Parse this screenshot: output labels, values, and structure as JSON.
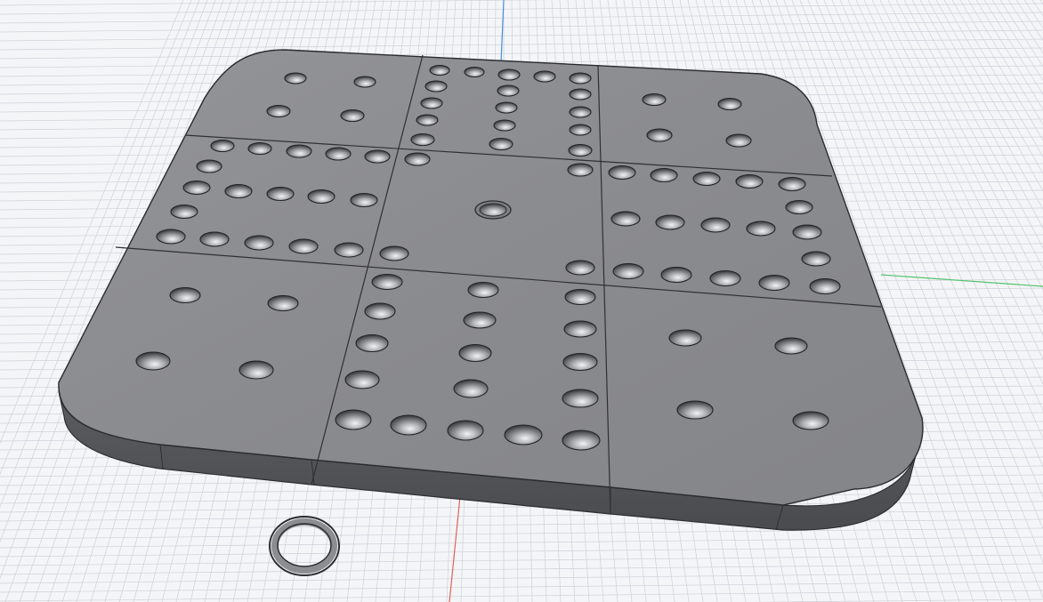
{
  "viewport": {
    "type": "3d-cad-viewport",
    "projection": "perspective",
    "grid": "on",
    "background_color": "#f4f5f7",
    "grid_color": "#c9ced6",
    "axis_colors": {
      "x": "#e0605a",
      "y": "#56c26f",
      "z": "#4a8fe6"
    }
  },
  "model": {
    "name": "",
    "body_color": "#8d8e92",
    "shape": "rounded square game board, 3x3 sections",
    "sections": [
      {
        "position": "top-left",
        "holes": 4
      },
      {
        "position": "top-center",
        "holes": 21
      },
      {
        "position": "top-right",
        "holes": 4
      },
      {
        "position": "middle-left",
        "holes": 21
      },
      {
        "position": "center",
        "holes": 1
      },
      {
        "position": "middle-right",
        "holes": 21
      },
      {
        "position": "bottom-left",
        "holes": 4
      },
      {
        "position": "bottom-center",
        "holes": 21
      },
      {
        "position": "bottom-right",
        "holes": 4
      }
    ],
    "center_hole": "counterbored"
  },
  "secondary_part": {
    "shape": "ring"
  }
}
